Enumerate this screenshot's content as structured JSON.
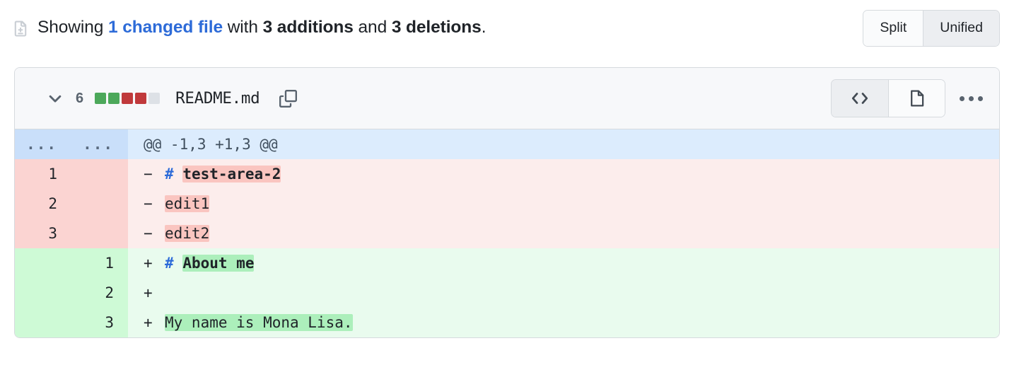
{
  "summary": {
    "icon": "diff-file-icon",
    "prefix": "Showing ",
    "changed_files_link": "1 changed file",
    "middle": " with ",
    "additions": "3 additions",
    "conjunction": " and ",
    "deletions": "3 deletions",
    "suffix": "."
  },
  "view_toggle": {
    "split_label": "Split",
    "unified_label": "Unified",
    "selected": "Unified"
  },
  "file": {
    "chevron_icon": "chevron-down-icon",
    "change_count": "6",
    "diffstat": {
      "blocks": [
        "#4ca85a",
        "#4ca85a",
        "#c0393b",
        "#c0393b",
        "#dde1e6"
      ],
      "additions": 2,
      "deletions": 2,
      "neutral": 1
    },
    "name": "README.md",
    "copy_icon": "copy-icon",
    "view_buttons": [
      {
        "name": "code-view",
        "icon": "code-brackets-icon",
        "selected": true
      },
      {
        "name": "preview-view",
        "icon": "file-document-icon",
        "selected": false
      }
    ],
    "kebab_icon": "kebab-menu-icon"
  },
  "diff": {
    "rows": [
      {
        "type": "hunk",
        "old_ln": "...",
        "new_ln": "...",
        "marker": "",
        "text": "@@ -1,3 +1,3 @@"
      },
      {
        "type": "del",
        "old_ln": "1",
        "new_ln": "",
        "marker": "−",
        "hash": "#",
        "word": "test-area-2",
        "bold": true,
        "text": "# test-area-2"
      },
      {
        "type": "del",
        "old_ln": "2",
        "new_ln": "",
        "marker": "−",
        "hash": "",
        "word": "edit1",
        "bold": false,
        "text": "edit1"
      },
      {
        "type": "del",
        "old_ln": "3",
        "new_ln": "",
        "marker": "−",
        "hash": "",
        "word": "edit2",
        "bold": false,
        "text": "edit2"
      },
      {
        "type": "add",
        "old_ln": "",
        "new_ln": "1",
        "marker": "+",
        "hash": "#",
        "word": "About me",
        "bold": true,
        "text": "# About me"
      },
      {
        "type": "add",
        "old_ln": "",
        "new_ln": "2",
        "marker": "+",
        "hash": "",
        "word": "",
        "bold": false,
        "text": ""
      },
      {
        "type": "add",
        "old_ln": "",
        "new_ln": "3",
        "marker": "+",
        "hash": "",
        "word": "My name is Mona Lisa.",
        "bold": false,
        "text": "My name is Mona Lisa."
      }
    ]
  },
  "colors": {
    "link": "#2d6bd8",
    "add_gutter": "#cefad6",
    "add_bg": "#e9fbee",
    "add_word": "#acefbb",
    "del_gutter": "#fbd4d2",
    "del_bg": "#fcedec",
    "del_word": "#fac5c0",
    "hunk_gutter": "#c9dffa",
    "hunk_bg": "#dcecfd",
    "border": "#d6dade",
    "header_bg": "#f7f8fa"
  }
}
